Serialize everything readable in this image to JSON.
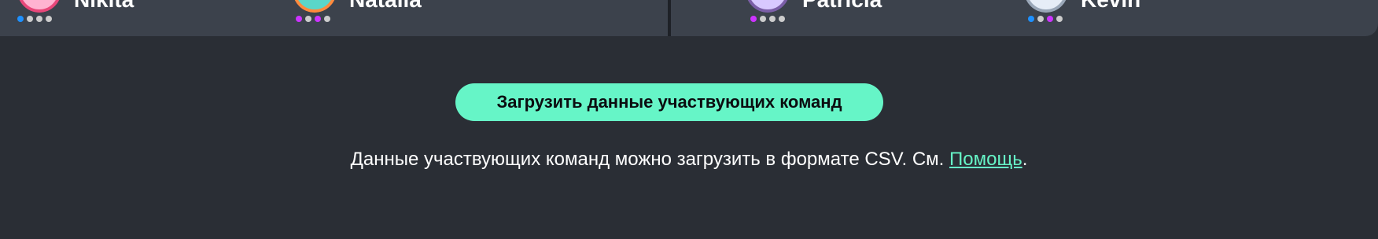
{
  "teams": {
    "players": [
      {
        "name": "Nikita",
        "avatar_colors": {
          "ring": "#e8477a",
          "fill": "#ffb3d1"
        },
        "dots": [
          "#1e90ff",
          "#cccccc",
          "#cccccc",
          "#cccccc"
        ]
      },
      {
        "name": "Natalia",
        "avatar_colors": {
          "ring": "#ff8a3d",
          "fill": "#5ad6c9"
        },
        "dots": [
          "#cc33ff",
          "#cccccc",
          "#cc33ff",
          "#cccccc"
        ]
      },
      {
        "name": "Patricia",
        "avatar_colors": {
          "ring": "#7b5ea7",
          "fill": "#d8c8ff"
        },
        "dots": [
          "#cc33ff",
          "#cccccc",
          "#cccccc",
          "#cccccc"
        ]
      },
      {
        "name": "Kevin",
        "avatar_colors": {
          "ring": "#9aa7b8",
          "fill": "#e6edf7"
        },
        "dots": [
          "#1e90ff",
          "#cccccc",
          "#cc33ff",
          "#cccccc"
        ]
      }
    ]
  },
  "upload": {
    "button_label": "Загрузить данные участвующих команд"
  },
  "info": {
    "text_before": "Данные участвующих команд можно загрузить в формате CSV. См. ",
    "help_link": "Помощь",
    "text_after": "."
  },
  "colors": {
    "background": "#2a2e35",
    "strip": "#3c424c",
    "accent": "#66f5c7"
  }
}
